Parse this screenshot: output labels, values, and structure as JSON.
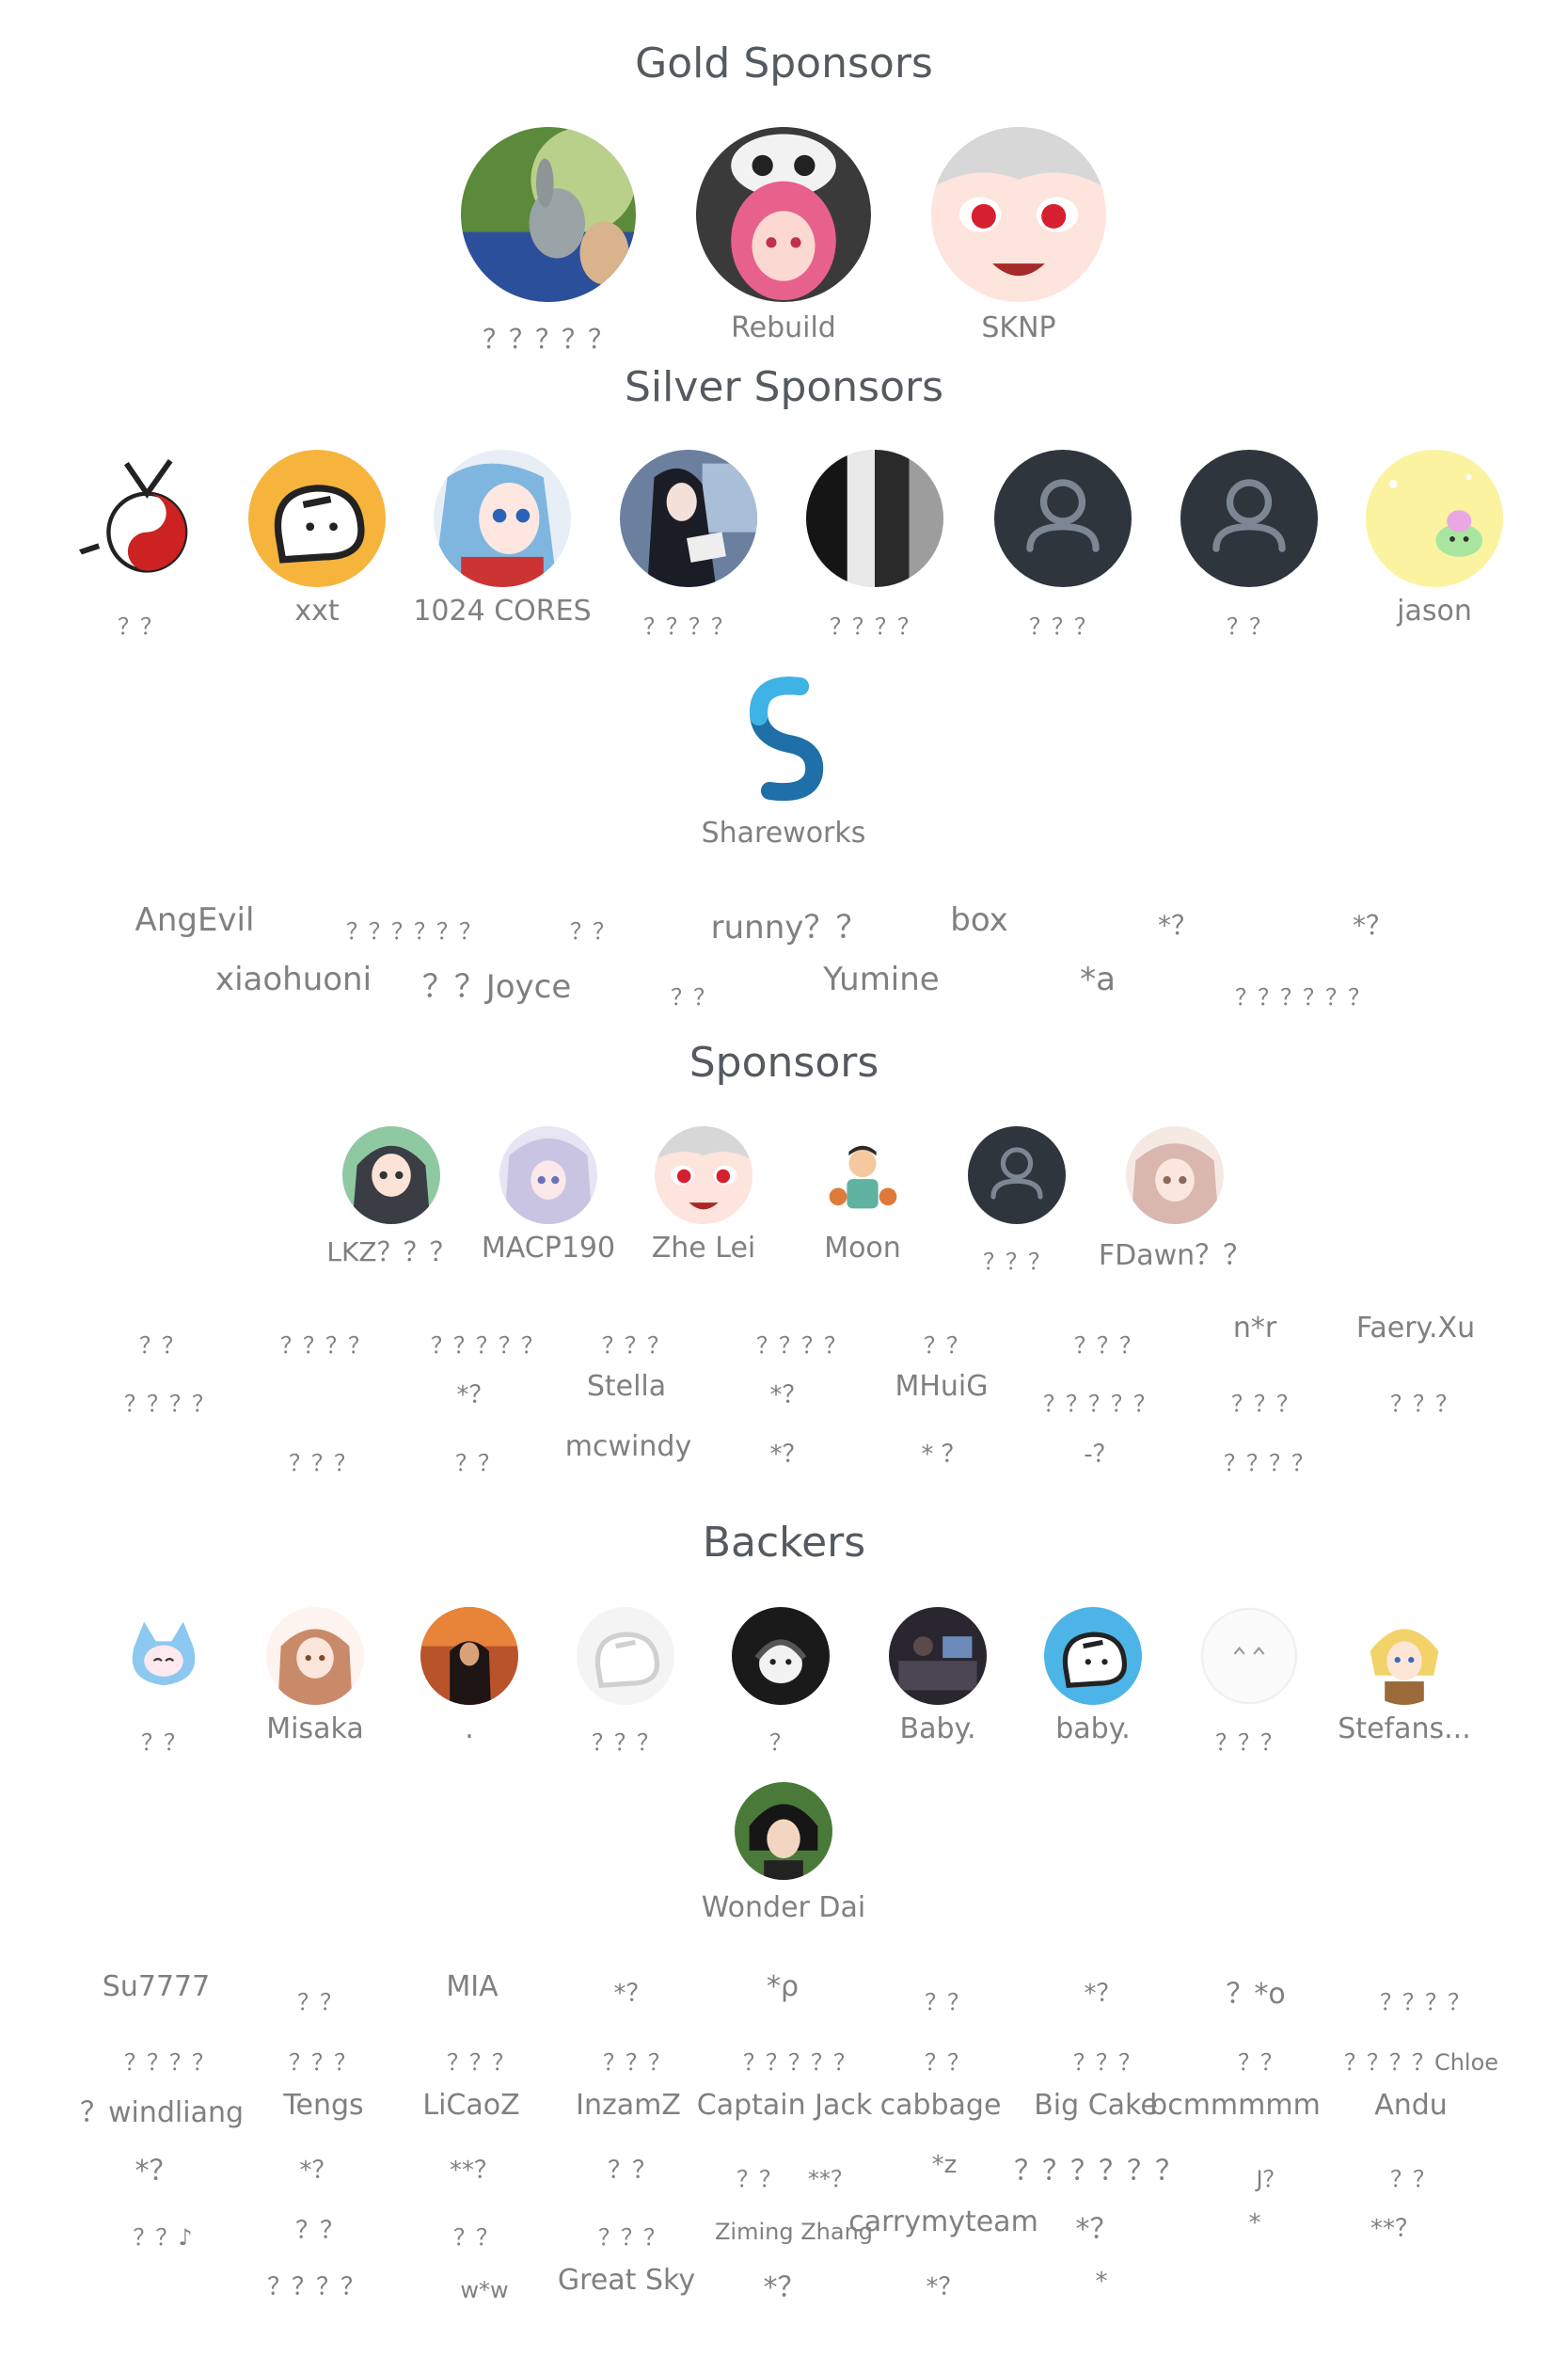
{
  "tiers": {
    "gold": "Gold Sponsors",
    "silver": "Silver Sponsors",
    "sponsors": "Sponsors",
    "backers": "Backers"
  },
  "gold_avatars": [
    {
      "name": "？？？？？",
      "icon": "avatar-photo-rabbit"
    },
    {
      "name": "Rebuild",
      "icon": "avatar-pink-hair-skull"
    },
    {
      "name": "SKNP",
      "icon": "avatar-anime-red-eyes"
    }
  ],
  "silver_avatars": [
    {
      "name": "？？",
      "icon": "avatar-yin-yang-creature"
    },
    {
      "name": "xxt",
      "icon": "avatar-ghost-orange"
    },
    {
      "name": "1024 CORES",
      "icon": "avatar-anime-blue-hair"
    },
    {
      "name": "？？？？",
      "icon": "avatar-anime-reading"
    },
    {
      "name": "？？？？",
      "icon": "avatar-photo-clothes"
    },
    {
      "name": "？？？",
      "icon": "avatar-default-user"
    },
    {
      "name": "？？",
      "icon": "avatar-default-user"
    },
    {
      "name": "jason",
      "icon": "avatar-yellow-slime"
    },
    {
      "name": "Shareworks",
      "icon": "avatar-shareworks-logo"
    }
  ],
  "silver_names": [
    "AngEvil",
    "？？？？？？",
    "？？",
    "runny？？",
    "box",
    "*？",
    "*？",
    "xiaohuoni",
    "？？Joyce",
    "？？",
    "Yumine",
    "*a",
    "？？？？？？"
  ],
  "sponsor_avatars": [
    {
      "name": "LKZ？？？",
      "icon": "avatar-anime-girl-hood"
    },
    {
      "name": "MACP190",
      "icon": "avatar-anime-silver-hair"
    },
    {
      "name": "Zhe Lei",
      "icon": "avatar-anime-red-eyes"
    },
    {
      "name": "Moon",
      "icon": "avatar-cartoon-man"
    },
    {
      "name": "？？？",
      "icon": "avatar-default-user"
    },
    {
      "name": "FDawn？？",
      "icon": "avatar-anime-pink-hair"
    }
  ],
  "sponsor_names": [
    "？？",
    "？？？？",
    "？？？？？",
    "？？？",
    "？？？？",
    "？？",
    "？？？",
    "n*r",
    "Faery.Xu",
    "？？？？",
    "*？",
    "Stella",
    "*？",
    "MHuiG",
    "？？？？？",
    "？？？",
    "？？？",
    "？？？",
    "？？",
    "mcwindy",
    "*？",
    "* ？",
    "-？",
    "？？？？"
  ],
  "backer_avatars": [
    {
      "name": "？？",
      "icon": "avatar-chibi-blue-cat"
    },
    {
      "name": "Misaka",
      "icon": "avatar-anime-misaka"
    },
    {
      "name": ".",
      "icon": "avatar-photo-sunset"
    },
    {
      "name": "？？？",
      "icon": "avatar-ghost-faded"
    },
    {
      "name": "？",
      "icon": "avatar-cat-headphones"
    },
    {
      "name": "Baby.",
      "icon": "avatar-photo-dark-room"
    },
    {
      "name": "baby.",
      "icon": "avatar-ghost-blue"
    },
    {
      "name": "？？？",
      "icon": "avatar-faint-face"
    },
    {
      "name": "Stefans...",
      "icon": "avatar-anime-blonde"
    },
    {
      "name": "Wonder Dai",
      "icon": "avatar-anime-dark-hair"
    }
  ],
  "backer_names": [
    "Su7777",
    "？？",
    "MIA",
    "*？",
    "*ρ",
    "？？",
    "*？",
    "？*o",
    "？？？？",
    "？？？？",
    "？？？",
    "？？？",
    "？？？",
    "？？？？？",
    "？？",
    "？？？",
    "？？",
    "？？？？Chloe",
    "？windliang",
    "Tengs",
    "LiCaoZ",
    "InzamZ",
    "Captain Jack",
    "cabbage",
    "Big Cake",
    "bcmmmmm",
    "Andu",
    "*？",
    "*？",
    "**？",
    "？？",
    "？？",
    "**？",
    "*z",
    "？？？？？？",
    "J？",
    "？？",
    "？？♪",
    "？？",
    "？？",
    "？？？",
    "Ziming Zhang",
    "carrymyteam",
    "*？",
    "*",
    "**？",
    "？？？？",
    "w*w",
    "Great Sky",
    "*？",
    "*？",
    "*"
  ],
  "colors": {
    "title": "#555a60",
    "label": "#808080",
    "default_avatar_bg": "#2f353d"
  }
}
